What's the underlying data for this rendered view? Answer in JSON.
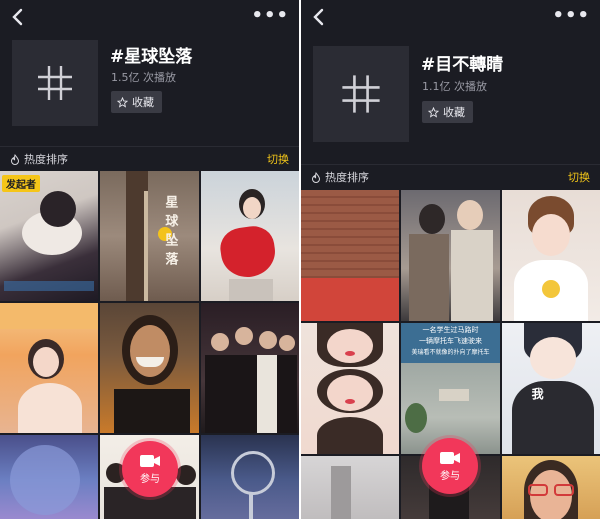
{
  "left": {
    "tag_title": "#星球坠落",
    "plays": "1.5亿 次播放",
    "favorite_label": "收藏",
    "sort_label": "热度排序",
    "switch_label": "切换",
    "starter_badge": "发起者",
    "cell_caption": "星球坠落",
    "join_label": "参与"
  },
  "right": {
    "tag_title": "#目不轉睛",
    "plays": "1.1亿 次播放",
    "favorite_label": "收藏",
    "sort_label": "热度排序",
    "switch_label": "切换",
    "cell_caption_1": "一名学生过马路时",
    "cell_caption_2": "一辆摩托车飞速驶来",
    "cell_caption_3": "美瑞看不就像的扑向了摩托车",
    "cell_me": "我",
    "join_label": "参与"
  },
  "colors": {
    "background": "#1b1c23",
    "accent_yellow": "#f0c419",
    "join_pink": "#f2375a"
  },
  "icons": [
    "back-arrow-icon",
    "more-dots-icon",
    "hash-icon",
    "star-icon",
    "flame-icon",
    "video-camera-icon"
  ]
}
